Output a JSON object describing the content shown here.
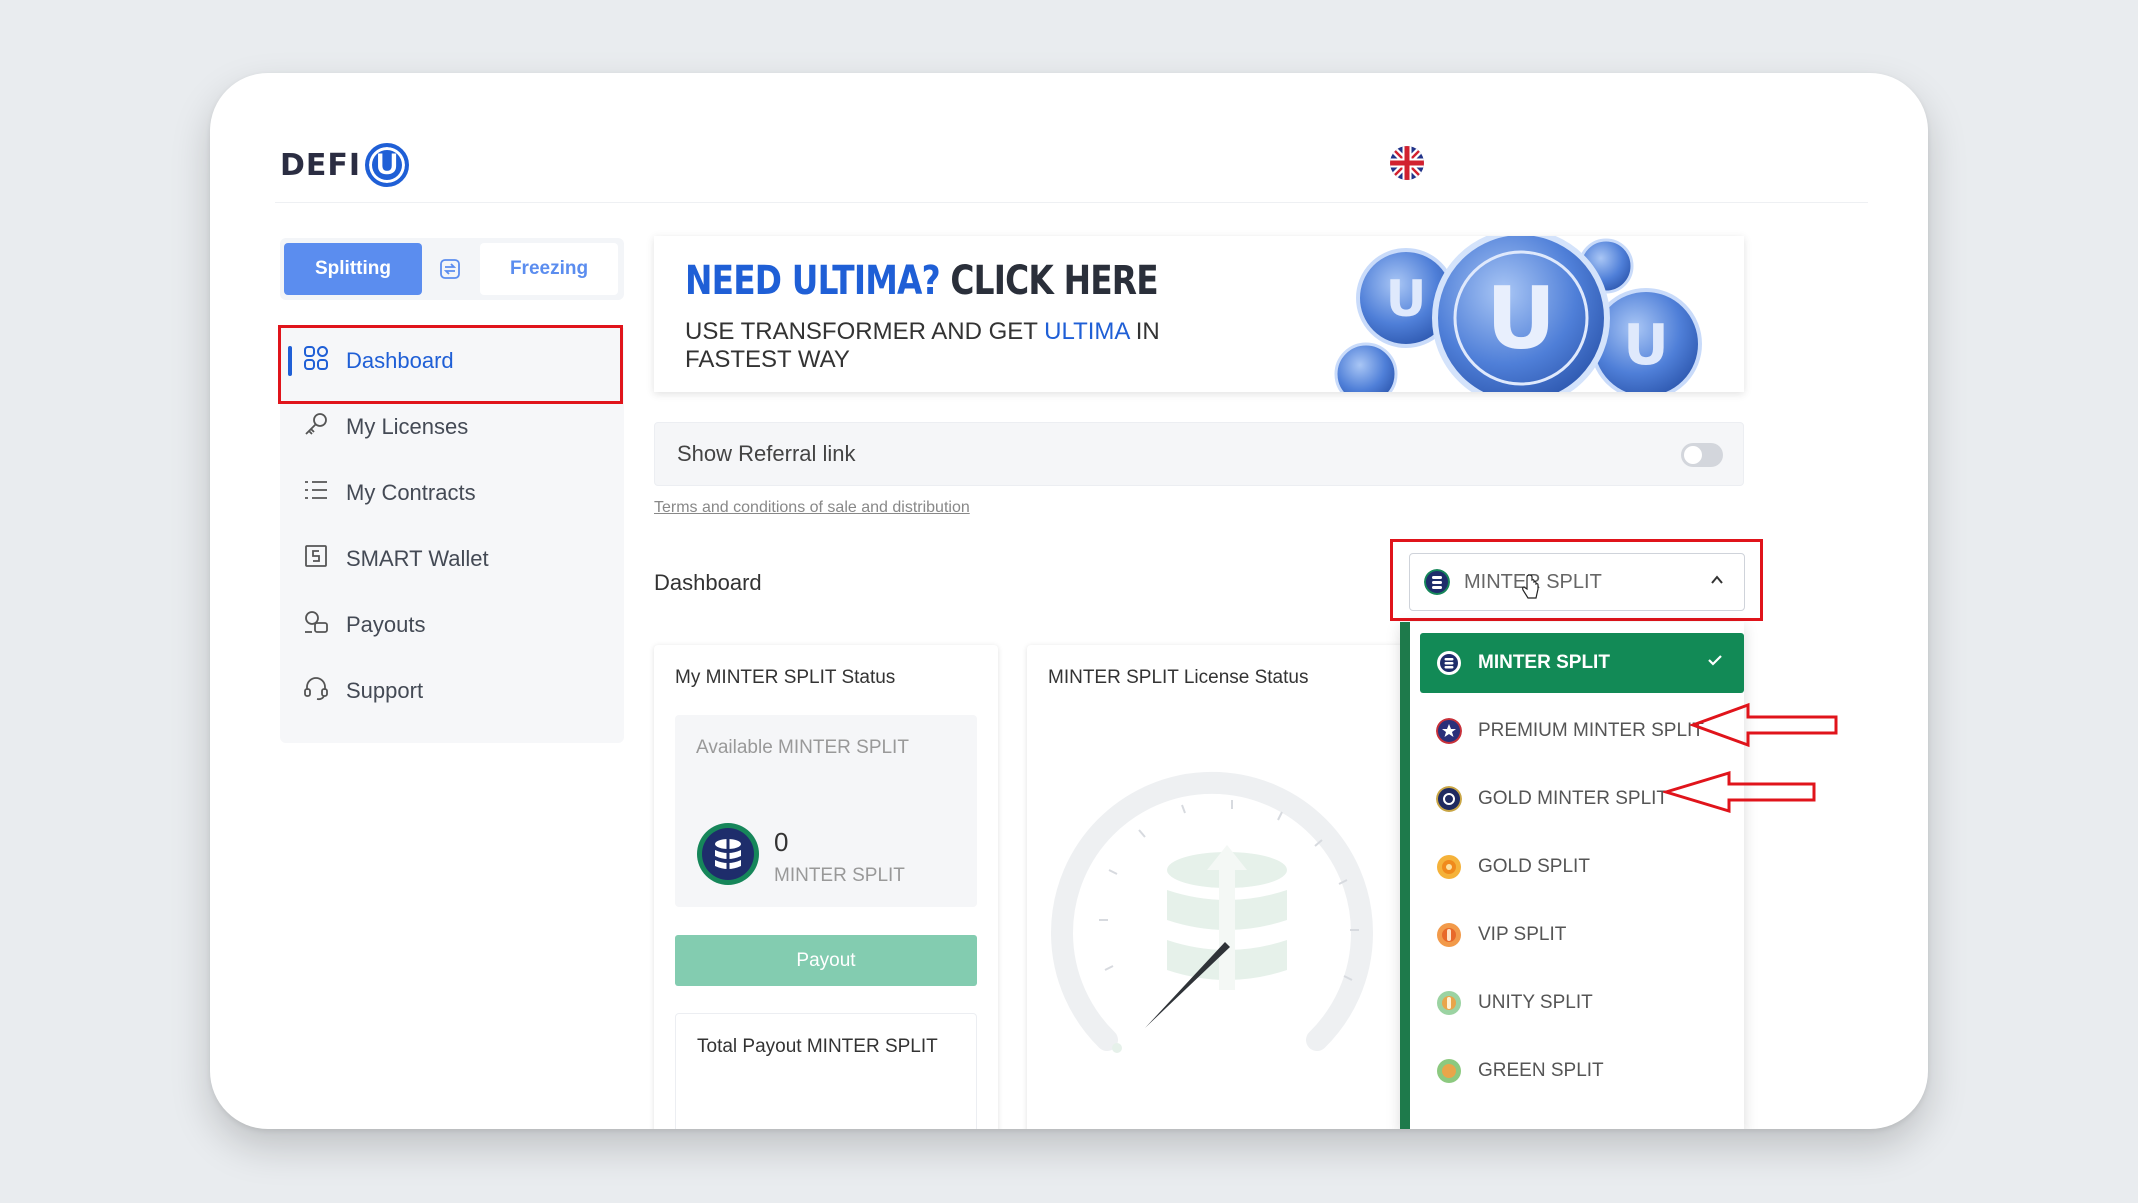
{
  "header": {
    "logo_text": "DEFI",
    "logo_letter": "U"
  },
  "mode_toggle": {
    "splitting_label": "Splitting",
    "freezing_label": "Freezing",
    "active": "Splitting"
  },
  "sidebar": {
    "items": [
      {
        "label": "Dashboard",
        "icon": "grid-icon",
        "active": true
      },
      {
        "label": "My Licenses",
        "icon": "key-icon",
        "active": false
      },
      {
        "label": "My Contracts",
        "icon": "list-icon",
        "active": false
      },
      {
        "label": "SMART Wallet",
        "icon": "wallet-icon",
        "active": false
      },
      {
        "label": "Payouts",
        "icon": "payouts-icon",
        "active": false
      },
      {
        "label": "Support",
        "icon": "headset-icon",
        "active": false
      }
    ]
  },
  "banner": {
    "title_blue": "NEED ULTIMA?",
    "title_dark": "CLICK HERE",
    "subtitle_part1": "USE TRANSFORMER AND GET",
    "subtitle_blue": "ULTIMA",
    "subtitle_part2": "IN FASTEST WAY"
  },
  "referral": {
    "label": "Show Referral link",
    "toggle_on": false
  },
  "terms_link": "Terms and conditions of sale and distribution",
  "dashboard": {
    "title": "Dashboard",
    "select": {
      "value": "MINTER SPLIT",
      "options": [
        {
          "label": "MINTER SPLIT",
          "color": "#1e2d6b",
          "selected": true
        },
        {
          "label": "PREMIUM MINTER SPLIT",
          "color": "#2a2f7a",
          "selected": false
        },
        {
          "label": "GOLD MINTER SPLIT",
          "color": "#1f2a60",
          "selected": false
        },
        {
          "label": "GOLD SPLIT",
          "color": "#f0a020",
          "selected": false
        },
        {
          "label": "VIP SPLIT",
          "color": "#f08030",
          "selected": false
        },
        {
          "label": "UNITY SPLIT",
          "color": "#6fbf7a",
          "selected": false
        },
        {
          "label": "GREEN SPLIT",
          "color": "#7cc070",
          "selected": false
        }
      ]
    },
    "status_card": {
      "title": "My MINTER SPLIT Status",
      "available_label": "Available MINTER SPLIT",
      "amount": "0",
      "unit": "MINTER SPLIT",
      "payout_button": "Payout",
      "total_label": "Total Payout MINTER SPLIT"
    },
    "license_card": {
      "title": "MINTER SPLIT License Status"
    }
  },
  "colors": {
    "accent_blue": "#1f5fd6",
    "selected_green": "#128a56",
    "highlight_red": "#e0141b",
    "payout_green": "#83ccb0"
  }
}
